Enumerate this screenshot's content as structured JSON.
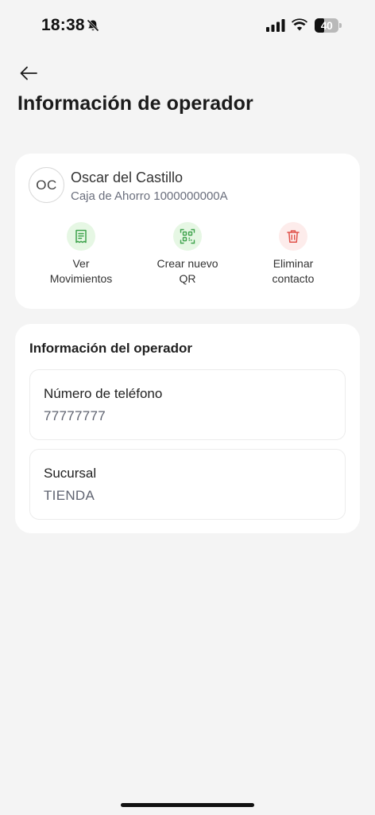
{
  "status_bar": {
    "time": "18:38",
    "battery": "40",
    "battery_level": 0.4
  },
  "header": {
    "title": "Información de operador"
  },
  "contact": {
    "initials": "OC",
    "name": "Oscar del Castillo",
    "account": "Caja de Ahorro 1000000000A",
    "actions": [
      {
        "line1": "Ver",
        "line2": "Movimientos",
        "icon": "receipt-icon",
        "color": "#3fa34d"
      },
      {
        "line1": "Crear nuevo",
        "line2": "QR",
        "icon": "qr-code-icon",
        "color": "#3fa34d"
      },
      {
        "line1": "Eliminar",
        "line2": "contacto",
        "icon": "trash-icon",
        "color": "#e0524a"
      }
    ]
  },
  "operator_info": {
    "title": "Información del operador",
    "fields": [
      {
        "label": "Número de teléfono",
        "value": "77777777"
      },
      {
        "label": "Sucursal",
        "value": "TIENDA"
      }
    ]
  }
}
